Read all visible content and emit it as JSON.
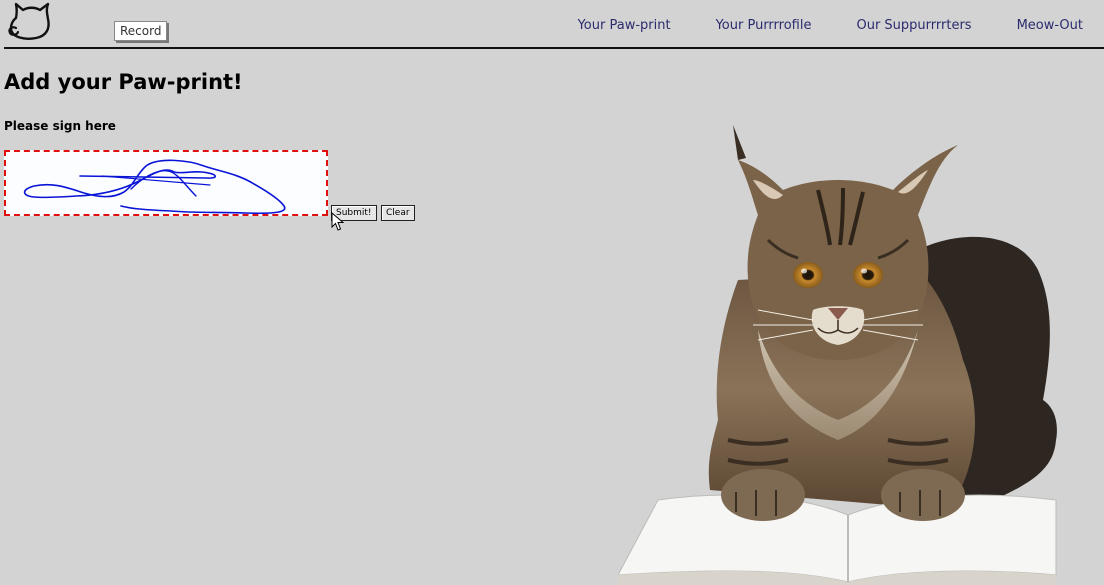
{
  "header": {
    "logo_icon": "cat-face-outline-icon",
    "record_label": "Record",
    "nav": [
      {
        "label": "Your Paw-print"
      },
      {
        "label": "Your Purrrrofile"
      },
      {
        "label": "Our Suppurrrrters"
      },
      {
        "label": "Meow-Out"
      }
    ],
    "nav_color": "#2b2b6e"
  },
  "main": {
    "title": "Add your Paw-print!",
    "sign_label": "Please sign here",
    "signature_pad": {
      "border_color": "#e01010",
      "ink_color": "#0a14d6"
    },
    "submit_label": "Submit!",
    "clear_label": "Clear"
  },
  "image": {
    "subject": "maine-coon-cat-on-open-book"
  }
}
